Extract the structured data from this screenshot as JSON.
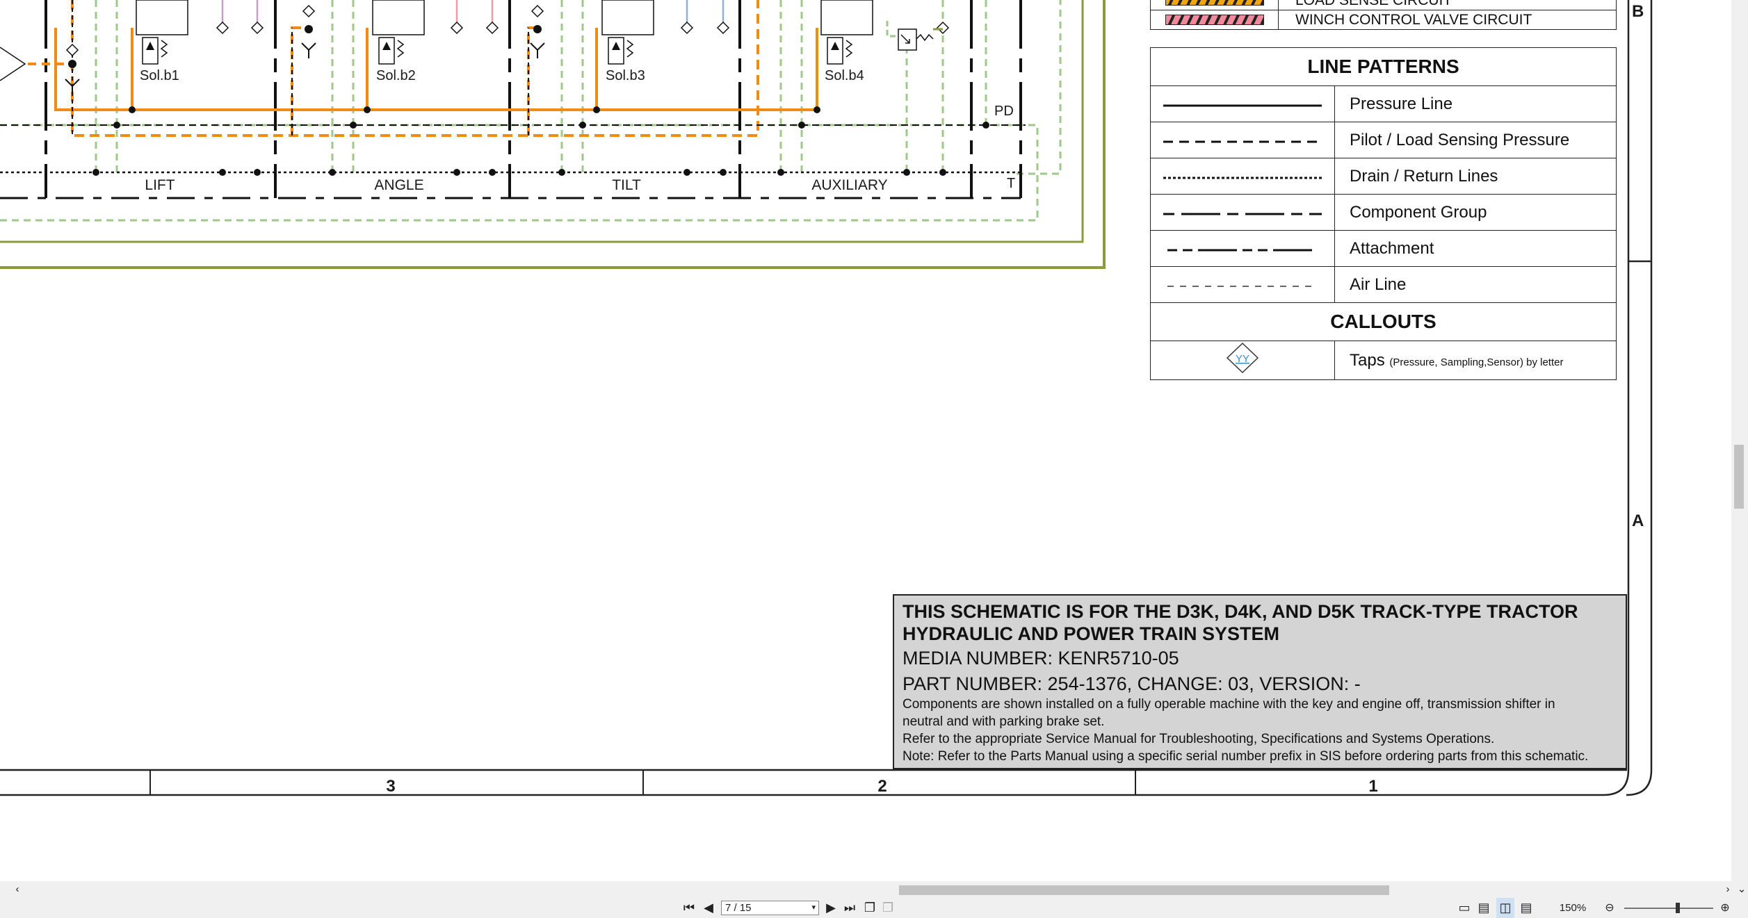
{
  "schematic": {
    "valve_sections": [
      {
        "label": "LIFT",
        "solenoid": "Sol.b1"
      },
      {
        "label": "ANGLE",
        "solenoid": "Sol.b2"
      },
      {
        "label": "TILT",
        "solenoid": "Sol.b3"
      },
      {
        "label": "AUXILIARY",
        "solenoid": "Sol.b4"
      }
    ],
    "port_pd": "PD",
    "port_t": "T",
    "zone_letters": [
      "B",
      "A"
    ],
    "grid_columns": [
      "3",
      "2",
      "1"
    ]
  },
  "top_legend": {
    "partial_row": "LOAD SENSE CIRCUIT",
    "winch_row": "WINCH CONTROL VALVE CIRCUIT",
    "colors": {
      "load_sense": "#f2a60c",
      "winch": "#f08a9a"
    }
  },
  "legend": {
    "line_patterns_title": "LINE PATTERNS",
    "line_patterns": [
      {
        "label": "Pressure Line",
        "pattern": "solid"
      },
      {
        "label": "Pilot / Load Sensing Pressure",
        "pattern": "dashed"
      },
      {
        "label": "Drain / Return Lines",
        "pattern": "dotted"
      },
      {
        "label": "Component Group",
        "pattern": "dash-long"
      },
      {
        "label": "Attachment",
        "pattern": "dash-dot"
      },
      {
        "label": "Air Line",
        "pattern": "thin-dashed"
      }
    ],
    "callouts_title": "CALLOUTS",
    "callout_symbol": "YY",
    "callout_main": "Taps",
    "callout_note": "(Pressure, Sampling,Sensor) by letter"
  },
  "title_block": {
    "heading": "THIS SCHEMATIC IS FOR THE D3K, D4K, AND D5K TRACK-TYPE TRACTOR HYDRAULIC AND POWER TRAIN SYSTEM",
    "media": "MEDIA NUMBER: KENR5710-05",
    "part": "PART NUMBER: 254-1376, CHANGE: 03, VERSION: -",
    "line1": "Components are shown installed on a fully operable machine with the key and engine off, transmission shifter in neutral and with parking brake set.",
    "line2": "Refer to the appropriate Service Manual for Troubleshooting, Specifications and Systems Operations.",
    "line3": "Note: Refer to the Parts Manual using a specific serial number prefix in SIS before ordering parts from this schematic."
  },
  "viewer": {
    "page_indicator": "7 / 15",
    "zoom": "150%"
  },
  "colors": {
    "pressure_orange": "#f08c14",
    "pilot_green": "#9fc98a",
    "group_olive": "#8a9a3c",
    "drain_pink": "#c89ad0"
  }
}
